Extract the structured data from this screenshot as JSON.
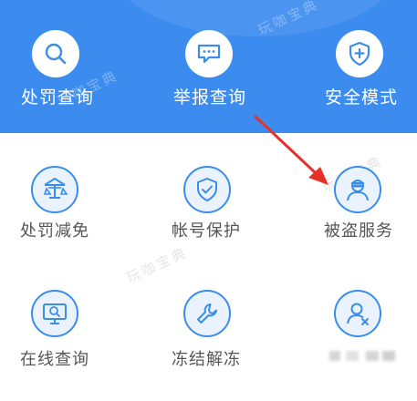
{
  "top_menu": [
    {
      "label": "处罚查询",
      "icon": "search-icon"
    },
    {
      "label": "举报查询",
      "icon": "chat-bubble-icon"
    },
    {
      "label": "安全模式",
      "icon": "shield-plus-icon"
    }
  ],
  "grid_menu": [
    {
      "label": "处罚减免",
      "icon": "scales-icon"
    },
    {
      "label": "帐号保护",
      "icon": "shield-check-icon"
    },
    {
      "label": "被盗服务",
      "icon": "thief-icon"
    },
    {
      "label": "在线查询",
      "icon": "monitor-search-icon"
    },
    {
      "label": "冻结解冻",
      "icon": "wrench-icon"
    },
    {
      "label": "",
      "icon": "user-remove-icon"
    }
  ],
  "watermark": "玩咖宝典",
  "colors": {
    "header_blue": "#3c8cf0",
    "icon_blue": "#3a8ee8",
    "arrow_red": "#e8302a"
  }
}
